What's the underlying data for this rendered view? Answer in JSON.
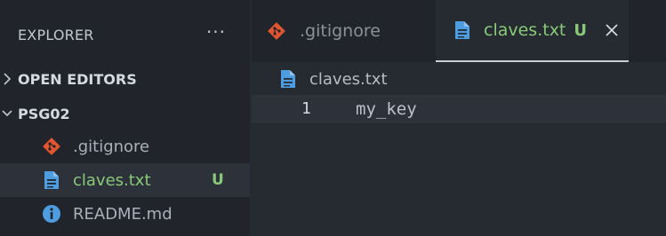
{
  "sidebar": {
    "title": "EXPLORER",
    "more_actions": "···",
    "sections": {
      "open_editors": "OPEN EDITORS",
      "folder": "PSG02"
    },
    "files": [
      {
        "name": ".gitignore",
        "icon": "git-icon",
        "badge": ""
      },
      {
        "name": "claves.txt",
        "icon": "text-file-icon",
        "badge": "U"
      },
      {
        "name": "README.md",
        "icon": "info-icon",
        "badge": ""
      }
    ]
  },
  "tabs": [
    {
      "label": ".gitignore",
      "icon": "git-icon"
    },
    {
      "label": "claves.txt",
      "icon": "text-file-icon",
      "badge": "U",
      "close": "close-icon"
    }
  ],
  "breadcrumb": {
    "file": "claves.txt",
    "icon": "text-file-icon"
  },
  "editor": {
    "lines": [
      {
        "number": "1",
        "text": "my_key"
      }
    ]
  },
  "colors": {
    "git": "#e2562f",
    "text_file": "#4d9de0",
    "info": "#4d9de0",
    "untracked": "#89ca78"
  }
}
